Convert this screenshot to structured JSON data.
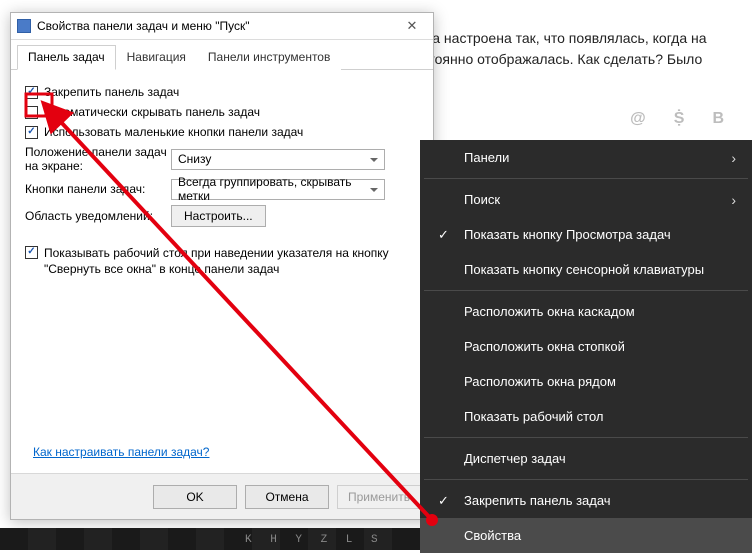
{
  "bg": {
    "text": "была настроена так, что появлялась, когда на постоянно отображалась. Как сделать? Было"
  },
  "social": {
    "at": "@",
    "ok": "ꙘК",
    "vk": "В"
  },
  "dialog": {
    "title": "Свойства панели задач и меню \"Пуск\"",
    "tabs": {
      "taskbar": "Панель задач",
      "nav": "Навигация",
      "toolbars": "Панели инструментов"
    },
    "chk_lock": "Закрепить панель задач",
    "chk_autohide": "Автоматически скрывать панель задач",
    "chk_small": "Использовать маленькие кнопки панели задач",
    "label_position": "Положение панели задач на экране:",
    "val_position": "Снизу",
    "label_buttons": "Кнопки панели задач:",
    "val_buttons": "Всегда группировать, скрывать метки",
    "label_notif": "Область уведомлений:",
    "btn_customize": "Настроить...",
    "chk_peek": "Показывать рабочий стол при наведении указателя на кнопку \"Свернуть все окна\" в конце панели задач",
    "help_link": "Как настраивать панели задач?",
    "btn_ok": "OK",
    "btn_cancel": "Отмена",
    "btn_apply": "Применить"
  },
  "ctx": {
    "panels": "Панели",
    "search": "Поиск",
    "show_taskview": "Показать кнопку Просмотра задач",
    "show_touchkb": "Показать кнопку сенсорной клавиатуры",
    "cascade": "Расположить окна каскадом",
    "stacked": "Расположить окна стопкой",
    "sidebyside": "Расположить окна рядом",
    "show_desktop": "Показать рабочий стол",
    "taskmgr": "Диспетчер задач",
    "lock": "Закрепить панель задач",
    "properties": "Свойства"
  },
  "taskbar_text": "K H Y Z L  S"
}
